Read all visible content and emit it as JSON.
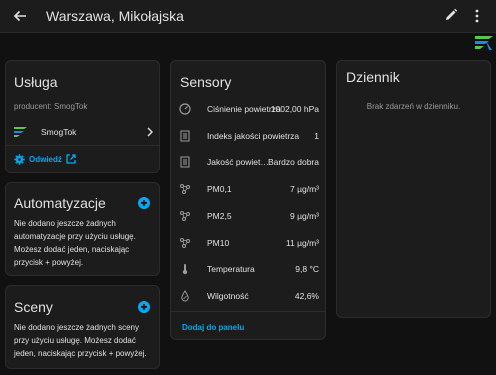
{
  "header": {
    "title": "Warszawa, Mikołajska",
    "back_icon": "arrow-left-icon",
    "edit_icon": "pencil-icon",
    "more_icon": "dots-vertical-icon"
  },
  "service": {
    "title": "Usługa",
    "producer": "producent: SmogTok",
    "device_name": "SmogTok",
    "visit_label": "Odwiedź"
  },
  "automations": {
    "title": "Automatyzacje",
    "description": "Nie dodano jeszcze żadnych automatyzacje przy użyciu usługę. Możesz dodać jeden, naciskając przycisk + powyżej."
  },
  "scenes": {
    "title": "Sceny",
    "description": "Nie dodano jeszcze żadnych sceny przy użyciu usługę. Możesz dodać jeden, naciskając przycisk + powyżej."
  },
  "sensors": {
    "title": "Sensory",
    "items": [
      {
        "name": "Ciśnienie powietrza",
        "value": "1002,00 hPa",
        "icon": "gauge-icon"
      },
      {
        "name": "Indeks jakości powietrza",
        "value": "1",
        "icon": "list-icon"
      },
      {
        "name": "Jakość powietrza",
        "value": "Bardzo dobra",
        "icon": "list-icon"
      },
      {
        "name": "PM0,1",
        "value": "7 µg/m³",
        "icon": "molecule-icon"
      },
      {
        "name": "PM2,5",
        "value": "9 µg/m³",
        "icon": "molecule-icon"
      },
      {
        "name": "PM10",
        "value": "11 µg/m³",
        "icon": "molecule-icon"
      },
      {
        "name": "Temperatura",
        "value": "9,8 °C",
        "icon": "thermometer-icon"
      },
      {
        "name": "Wilgotność",
        "value": "42,6%",
        "icon": "humidity-icon"
      }
    ],
    "add_to_panel": "Dodaj do panelu"
  },
  "log": {
    "title": "Dziennik",
    "empty_text": "Brak zdarzeń w dzienniku."
  },
  "colors": {
    "accent": "#03a9f4",
    "card": "#1c1c1c",
    "background": "#111111",
    "logo_green": "#57c84d",
    "logo_blue": "#1e88e5"
  }
}
